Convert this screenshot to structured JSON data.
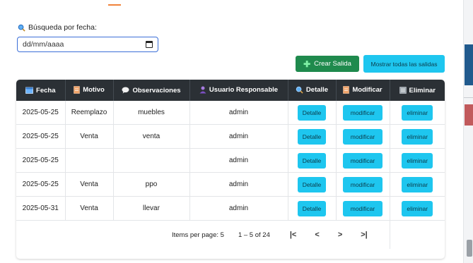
{
  "search": {
    "label": "Búsqueda por fecha:",
    "date_placeholder": "dd/mm/aaaa"
  },
  "actions": {
    "crear_label": "Crear Salida",
    "mostrar_label": "Mostrar todas las salidas"
  },
  "table": {
    "headers": {
      "fecha": "Fecha",
      "motivo": "Motivo",
      "observaciones": "Observaciones",
      "usuario": "Usuario Responsable",
      "detalle": "Detalle",
      "modificar": "Modificar",
      "eliminar": "Eliminar"
    },
    "rows": [
      {
        "fecha": "2025-05-25",
        "motivo": "Reemplazo",
        "observaciones": "muebles",
        "usuario": "admin",
        "detalle": "Detalle",
        "modificar": "modificar",
        "eliminar": "eliminar"
      },
      {
        "fecha": "2025-05-25",
        "motivo": "Venta",
        "observaciones": "venta",
        "usuario": "admin",
        "detalle": "Detalle",
        "modificar": "modificar",
        "eliminar": "eliminar"
      },
      {
        "fecha": "2025-05-25",
        "motivo": "",
        "observaciones": "",
        "usuario": "admin",
        "detalle": "Detalle",
        "modificar": "modificar",
        "eliminar": "eliminar"
      },
      {
        "fecha": "2025-05-25",
        "motivo": "Venta",
        "observaciones": "ppo",
        "usuario": "admin",
        "detalle": "Detalle",
        "modificar": "modificar",
        "eliminar": "eliminar"
      },
      {
        "fecha": "2025-05-31",
        "motivo": "Venta",
        "observaciones": "llevar",
        "usuario": "admin",
        "detalle": "Detalle",
        "modificar": "modificar",
        "eliminar": "eliminar"
      }
    ]
  },
  "paginator": {
    "items_per_page_label": "Items per page:",
    "items_per_page": "5",
    "range": "1 – 5 of 24",
    "first": "|<",
    "prev": "<",
    "next": ">",
    "last": ">|"
  },
  "colors": {
    "header_bg": "#2b3035",
    "action_cyan": "#1ec6ef",
    "create_green": "#1f8a4d"
  }
}
